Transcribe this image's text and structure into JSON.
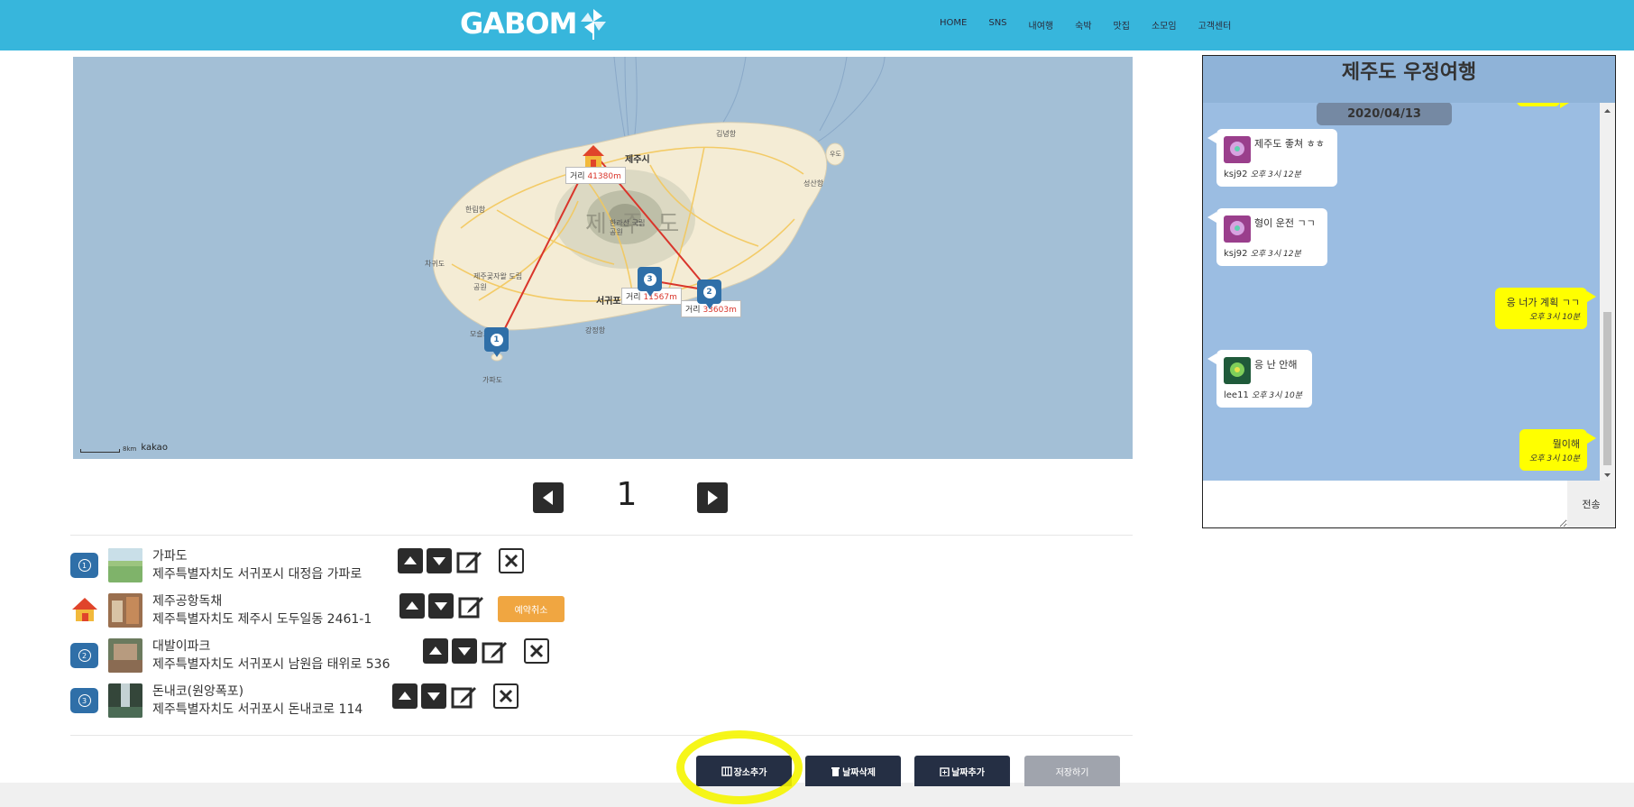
{
  "header": {
    "logo": "GABOM",
    "nav": [
      "HOME",
      "SNS",
      "내여행",
      "숙박",
      "맛집",
      "소모임",
      "고객센터"
    ]
  },
  "map": {
    "place_labels": [
      "제주시",
      "서귀포",
      "제 주 도",
      "한라산 국립공원",
      "김녕항",
      "성산항",
      "우도",
      "한림항",
      "제주곶자왈 도립공원",
      "차귀도",
      "모슬포항",
      "가파도",
      "강정항"
    ],
    "distances": [
      {
        "prefix": "거리",
        "value": "41380m"
      },
      {
        "prefix": "거리",
        "value": "11567m"
      },
      {
        "prefix": "거리",
        "value": "33603m"
      }
    ],
    "pins": [
      "1",
      "2",
      "3"
    ],
    "scale_label": "8km",
    "attribution": "kakao"
  },
  "pager": {
    "current": "1"
  },
  "places": [
    {
      "badge": "1",
      "name": "가파도",
      "address": "제주특별자치도 서귀포시 대정읍 가파로",
      "type": "spot"
    },
    {
      "badge": "",
      "name": "제주공항독채",
      "address": "제주특별자치도 제주시 도두일동 2461-1",
      "type": "lodging",
      "reserve_cancel": "예약취소"
    },
    {
      "badge": "2",
      "name": "대발이파크",
      "address": "제주특별자치도 서귀포시 남원읍 태위로 536",
      "type": "spot"
    },
    {
      "badge": "3",
      "name": "돈내코(원앙폭포)",
      "address": "제주특별자치도 서귀포시 돈내코로 114",
      "type": "spot"
    }
  ],
  "buttons": {
    "add_place": "장소추가",
    "delete_day": "날짜삭제",
    "add_day": "날짜추가",
    "save": "저장하기"
  },
  "chat": {
    "title": "제주도 우정여행",
    "date": "2020/04/13",
    "messages": [
      {
        "mine": false,
        "text": "제주도 좋쳐 ㅎㅎ",
        "user": "ksj92",
        "time": "오후 3시 12분"
      },
      {
        "mine": false,
        "text": "형이 운전 ㄱㄱ",
        "user": "ksj92",
        "time": "오후 3시 12분"
      },
      {
        "mine": true,
        "text": "응 너가 계획 ㄱㄱ",
        "time": "오후 3시 10분"
      },
      {
        "mine": false,
        "text": "응 난 안해",
        "user": "lee11",
        "time": "오후 3시 10분"
      },
      {
        "mine": true,
        "text": "뭘이해",
        "time": "오후 3시 10분"
      }
    ],
    "send": "전송"
  },
  "colors": {
    "header": "#37b6dc",
    "map_sea": "#a3bfd6",
    "route": "#d9352b",
    "pin": "#2f6fa8",
    "chat_bg": "#9bbde2",
    "my_bubble": "#ffff00",
    "reserve": "#f0a641",
    "button_dark": "#252f44"
  }
}
